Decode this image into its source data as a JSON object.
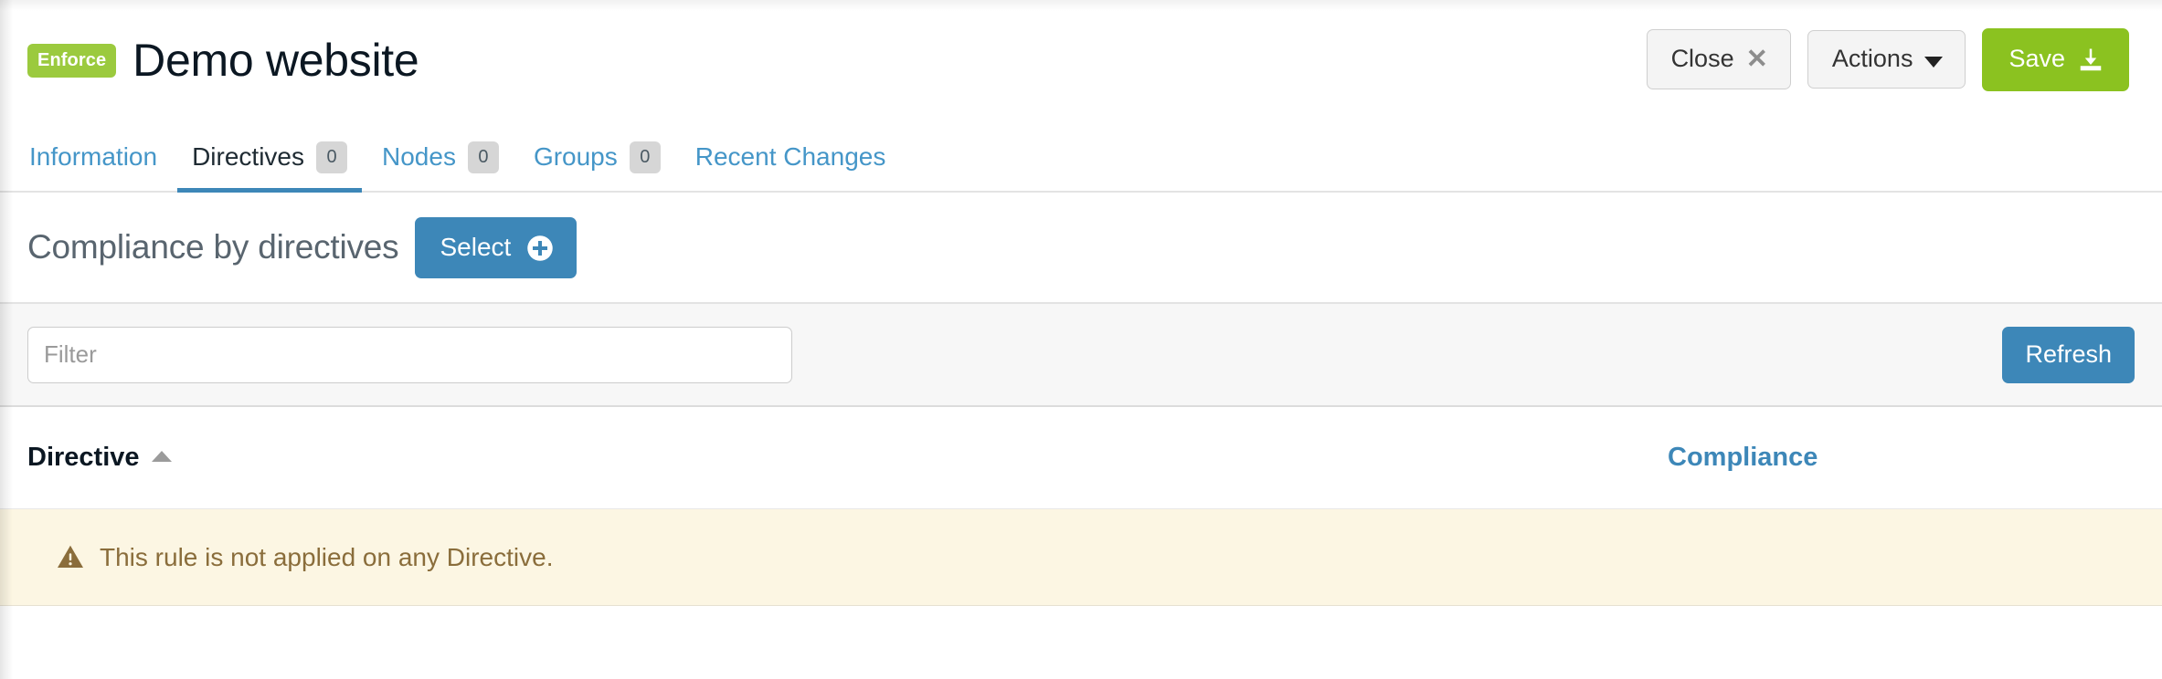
{
  "header": {
    "badge": "Enforce",
    "title": "Demo website",
    "buttons": {
      "close_label": "Close",
      "close_icon": "close-x-icon",
      "actions_label": "Actions",
      "actions_icon": "caret-down-icon",
      "save_label": "Save",
      "save_icon": "save-download-icon"
    }
  },
  "tabs": [
    {
      "label": "Information",
      "count": null,
      "active": false
    },
    {
      "label": "Directives",
      "count": "0",
      "active": true
    },
    {
      "label": "Nodes",
      "count": "0",
      "active": false
    },
    {
      "label": "Groups",
      "count": "0",
      "active": false
    },
    {
      "label": "Recent Changes",
      "count": null,
      "active": false
    }
  ],
  "compliance_section": {
    "title": "Compliance by directives",
    "select_label": "Select",
    "select_icon": "plus-circle-icon"
  },
  "filter_bar": {
    "placeholder": "Filter",
    "value": "",
    "refresh_label": "Refresh"
  },
  "table": {
    "columns": {
      "directive": "Directive",
      "compliance": "Compliance"
    },
    "sort": {
      "column": "Directive",
      "direction": "asc",
      "icon": "sort-ascending-icon"
    },
    "rows": [],
    "empty_message": "This rule is not applied on any Directive.",
    "empty_icon": "warning-triangle-icon"
  },
  "colors": {
    "badge_green": "#9bca3e",
    "save_green": "#8bc220",
    "accent_blue": "#3d87b8",
    "link_blue": "#4596c8",
    "warning_bg": "#fcf6e3",
    "warning_text": "#8a6d3b",
    "filter_bar_bg": "#f7f7f7",
    "title_dark": "#0b1722"
  }
}
